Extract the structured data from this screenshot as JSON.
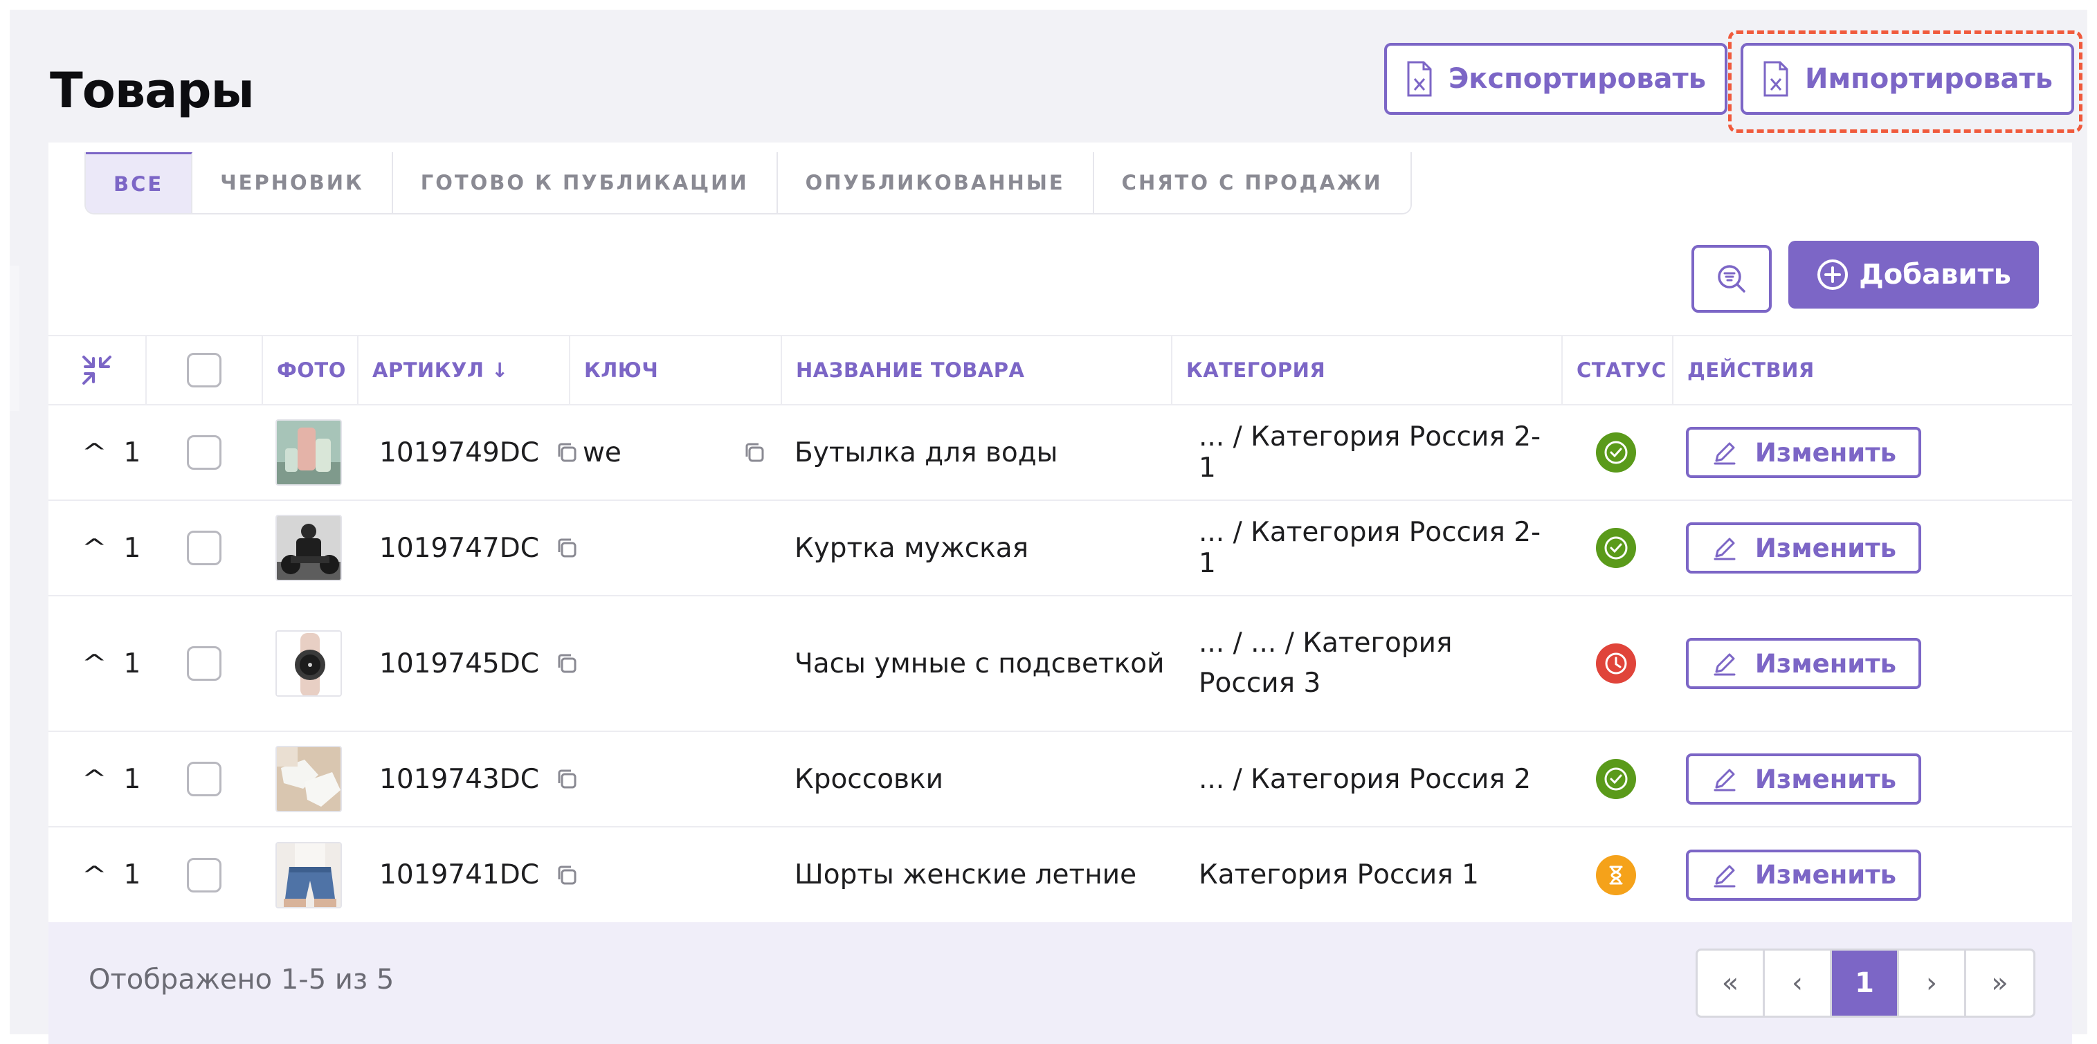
{
  "page": {
    "title": "Товары"
  },
  "toolbar": {
    "export_label": "Экспортировать",
    "import_label": "Импортировать"
  },
  "tabs": [
    {
      "label": "ВСЕ",
      "active": true
    },
    {
      "label": "ЧЕРНОВИК",
      "active": false
    },
    {
      "label": "ГОТОВО К ПУБЛИКАЦИИ",
      "active": false
    },
    {
      "label": "ОПУБЛИКОВАННЫЕ",
      "active": false
    },
    {
      "label": "СНЯТО С ПРОДАЖИ",
      "active": false
    }
  ],
  "actions": {
    "add_label": "Добавить",
    "filter_icon": "filter-search-icon"
  },
  "table": {
    "columns": {
      "photo": "ФОТО",
      "sku": "АРТИКУЛ ↓",
      "key": "КЛЮЧ",
      "name": "НАЗВАНИЕ ТОВАРА",
      "category": "КАТЕГОРИЯ",
      "status": "СТАТУС",
      "actions": "ДЕЙСТВИЯ"
    },
    "rows": [
      {
        "count": "1",
        "sku": "1019749DC",
        "key": "we",
        "name": "Бутылка для воды",
        "category": "... / Категория Россия 2-1",
        "status": "published",
        "edit": "Изменить"
      },
      {
        "count": "1",
        "sku": "1019747DC",
        "key": "",
        "name": "Куртка мужская",
        "category": "... / Категория Россия 2-1",
        "status": "published",
        "edit": "Изменить"
      },
      {
        "count": "1",
        "sku": "1019745DC",
        "key": "",
        "name": "Часы умные с подсветкой",
        "category": "... / ... / Категория Россия 3",
        "status": "withdrawn",
        "edit": "Изменить"
      },
      {
        "count": "1",
        "sku": "1019743DC",
        "key": "",
        "name": "Кроссовки",
        "category": "... / Категория Россия 2",
        "status": "published",
        "edit": "Изменить"
      },
      {
        "count": "1",
        "sku": "1019741DC",
        "key": "",
        "name": "Шорты женские летние",
        "category": "Категория Россия 1",
        "status": "pending",
        "edit": "Изменить"
      }
    ]
  },
  "footer": {
    "info": "Отображено 1-5 из 5"
  },
  "pagination": {
    "first": "«",
    "prev": "‹",
    "current": "1",
    "next": "›",
    "last": "»"
  },
  "colors": {
    "accent": "#7c66c6",
    "published": "#5a9a1a",
    "withdrawn": "#e0443a",
    "pending": "#f5a21a",
    "highlight": "#f05a3c"
  }
}
